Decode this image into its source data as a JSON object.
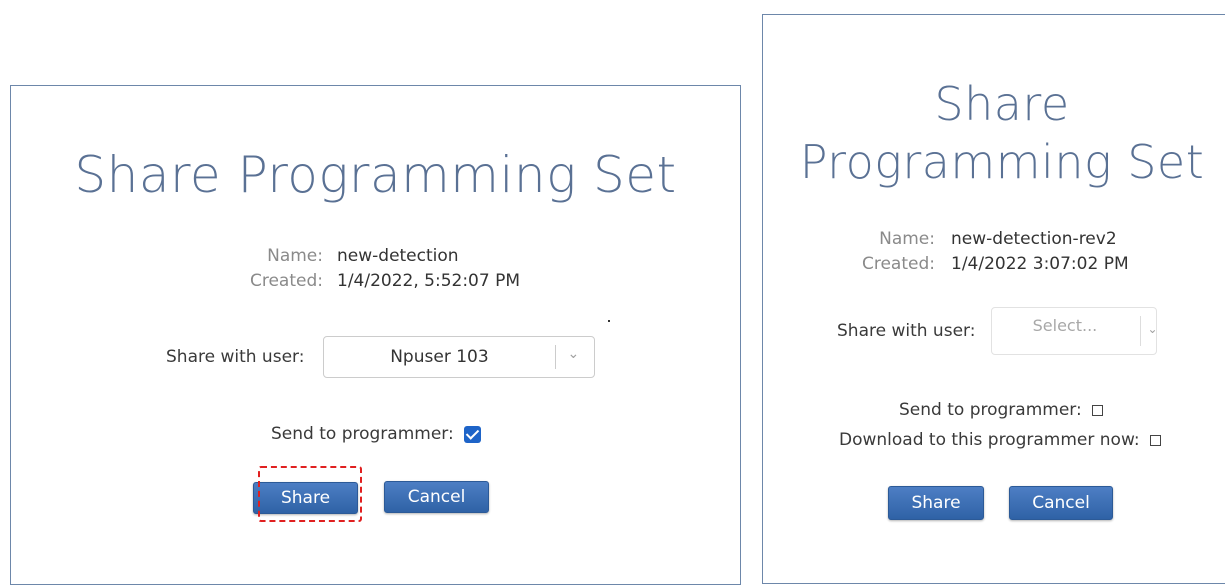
{
  "left_dialog": {
    "title": "Share Programming Set",
    "name_label": "Name:",
    "name_value": "new-detection",
    "created_label": "Created:",
    "created_value": "1/4/2022, 5:52:07 PM",
    "share_with_label": "Share with user:",
    "share_with_value": "Npuser 103",
    "send_to_programmer_label": "Send to programmer:",
    "send_to_programmer_checked": true,
    "share_button": "Share",
    "cancel_button": "Cancel"
  },
  "right_dialog": {
    "title_line1": "Share",
    "title_line2": "Programming Set",
    "name_label": "Name:",
    "name_value": "new-detection-rev2",
    "created_label": "Created:",
    "created_value": "1/4/2022 3:07:02 PM",
    "share_with_label": "Share with user:",
    "share_with_placeholder": "Select...",
    "send_to_programmer_label": "Send to programmer:",
    "send_to_programmer_checked": false,
    "download_now_label": "Download to this programmer now:",
    "download_now_checked": false,
    "share_button": "Share",
    "cancel_button": "Cancel"
  },
  "icons": {
    "dropdown": "chevron-down-icon",
    "checked": "checkbox-checked-icon",
    "unchecked": "checkbox-unchecked-icon"
  },
  "colors": {
    "title": "#5a7194",
    "button": "#3b6db3",
    "checkbox_checked": "#1e64c8",
    "highlight": "#e02020",
    "dialog_border": "#6d87aa"
  }
}
